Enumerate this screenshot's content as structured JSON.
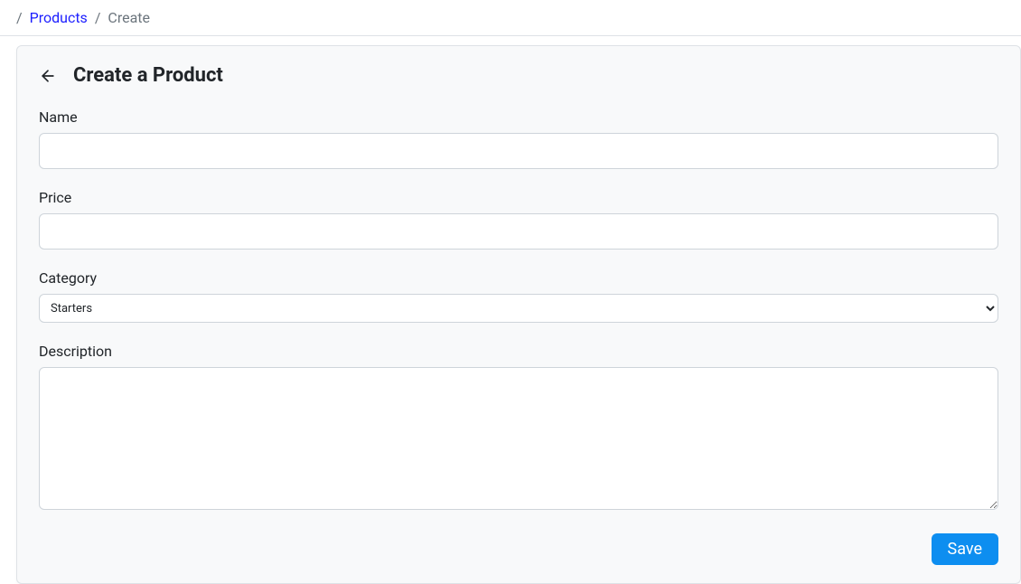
{
  "breadcrumb": {
    "items": [
      {
        "label": "Products",
        "link": true
      },
      {
        "label": "Create",
        "link": false
      }
    ]
  },
  "card": {
    "title": "Create a Product",
    "back_icon": "arrow-left"
  },
  "form": {
    "name": {
      "label": "Name",
      "value": ""
    },
    "price": {
      "label": "Price",
      "value": ""
    },
    "category": {
      "label": "Category",
      "selected": "Starters",
      "options": [
        "Starters"
      ]
    },
    "description": {
      "label": "Description",
      "value": ""
    }
  },
  "actions": {
    "save_label": "Save"
  }
}
